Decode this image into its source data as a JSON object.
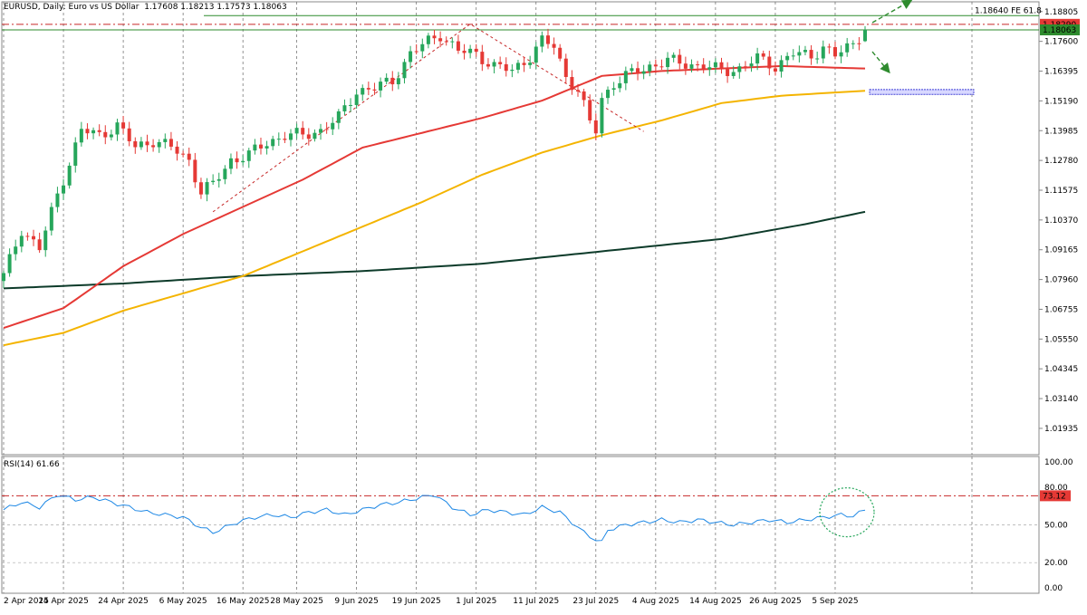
{
  "header": {
    "symbol": "EURUSD",
    "timeframe": "Daily",
    "description": "Euro vs US Dollar",
    "ohlc": "1.17608 1.18213 1.17573 1.18063"
  },
  "rsi_header": "RSI(14) 61.66",
  "fe_label": "1.18640 FE 61.8",
  "colors": {
    "bull": "#26a65b",
    "bear": "#e53935",
    "ma50": "#e53935",
    "ma100": "#f4b400",
    "ma200": "#0d3b2a",
    "rsi": "#1e88e5",
    "fe_line": "#2e8b2e",
    "resist": "#c62828",
    "target_box": "#3f3fd6",
    "badge_red": "#e53935",
    "badge_green": "#2e8b2e"
  },
  "price_badges": [
    {
      "value": "1.18290",
      "kind": "red"
    },
    {
      "value": "1.18063",
      "kind": "green"
    }
  ],
  "chart_data": [
    {
      "type": "candlestick",
      "title": "EURUSD, Daily: Euro vs US Dollar",
      "ylim": [
        1.0087,
        1.192
      ],
      "y_ticks": [
        "1.18805",
        "1.17600",
        "1.16395",
        "1.15190",
        "1.13985",
        "1.12780",
        "1.11575",
        "1.10370",
        "1.09165",
        "1.07960",
        "1.06755",
        "1.05550",
        "1.04345",
        "1.03140",
        "1.01935"
      ],
      "x_ticks": [
        "2 Apr 2025",
        "14 Apr 2025",
        "24 Apr 2025",
        "6 May 2025",
        "16 May 2025",
        "28 May 2025",
        "9 Jun 2025",
        "19 Jun 2025",
        "1 Jul 2025",
        "11 Jul 2025",
        "23 Jul 2025",
        "4 Aug 2025",
        "14 Aug 2025",
        "26 Aug 2025",
        "5 Sep 2025"
      ],
      "anchors": [
        [
          0,
          1.081
        ],
        [
          3,
          1.1
        ],
        [
          6,
          1.092
        ],
        [
          9,
          1.114
        ],
        [
          13,
          1.14
        ],
        [
          16,
          1.138
        ],
        [
          19,
          1.142
        ],
        [
          22,
          1.133
        ],
        [
          25,
          1.136
        ],
        [
          28,
          1.133
        ],
        [
          31,
          1.128
        ],
        [
          33,
          1.115
        ],
        [
          35,
          1.118
        ],
        [
          38,
          1.128
        ],
        [
          41,
          1.13
        ],
        [
          44,
          1.135
        ],
        [
          47,
          1.138
        ],
        [
          50,
          1.138
        ],
        [
          53,
          1.14
        ],
        [
          56,
          1.145
        ],
        [
          59,
          1.156
        ],
        [
          62,
          1.157
        ],
        [
          65,
          1.16
        ],
        [
          68,
          1.171
        ],
        [
          71,
          1.176
        ],
        [
          73,
          1.179
        ],
        [
          76,
          1.172
        ],
        [
          79,
          1.171
        ],
        [
          82,
          1.166
        ],
        [
          85,
          1.164
        ],
        [
          88,
          1.17
        ],
        [
          90,
          1.176
        ],
        [
          92,
          1.174
        ],
        [
          94,
          1.162
        ],
        [
          96,
          1.156
        ],
        [
          98,
          1.143
        ],
        [
          99,
          1.14
        ],
        [
          100,
          1.153
        ],
        [
          102,
          1.159
        ],
        [
          105,
          1.163
        ],
        [
          108,
          1.166
        ],
        [
          111,
          1.168
        ],
        [
          114,
          1.167
        ],
        [
          117,
          1.166
        ],
        [
          120,
          1.164
        ],
        [
          123,
          1.165
        ],
        [
          126,
          1.169
        ],
        [
          129,
          1.166
        ],
        [
          132,
          1.171
        ],
        [
          135,
          1.17
        ],
        [
          137,
          1.174
        ],
        [
          139,
          1.17
        ],
        [
          142,
          1.175
        ],
        [
          144,
          1.1806
        ]
      ],
      "ma50": [
        [
          0,
          1.06
        ],
        [
          10,
          1.068
        ],
        [
          20,
          1.085
        ],
        [
          30,
          1.098
        ],
        [
          40,
          1.109
        ],
        [
          50,
          1.12
        ],
        [
          60,
          1.133
        ],
        [
          70,
          1.139
        ],
        [
          80,
          1.145
        ],
        [
          90,
          1.152
        ],
        [
          100,
          1.162
        ],
        [
          110,
          1.164
        ],
        [
          120,
          1.165
        ],
        [
          130,
          1.166
        ],
        [
          144,
          1.165
        ]
      ],
      "ma100": [
        [
          0,
          1.053
        ],
        [
          10,
          1.058
        ],
        [
          20,
          1.067
        ],
        [
          30,
          1.074
        ],
        [
          40,
          1.081
        ],
        [
          50,
          1.091
        ],
        [
          60,
          1.101
        ],
        [
          70,
          1.111
        ],
        [
          80,
          1.122
        ],
        [
          90,
          1.131
        ],
        [
          100,
          1.138
        ],
        [
          110,
          1.144
        ],
        [
          120,
          1.151
        ],
        [
          130,
          1.154
        ],
        [
          144,
          1.156
        ]
      ],
      "ma200": [
        [
          0,
          1.076
        ],
        [
          20,
          1.078
        ],
        [
          40,
          1.081
        ],
        [
          60,
          1.083
        ],
        [
          80,
          1.086
        ],
        [
          100,
          1.091
        ],
        [
          120,
          1.096
        ],
        [
          134,
          1.102
        ],
        [
          144,
          1.107
        ]
      ],
      "fe_level": 1.1864,
      "resist_level": 1.1829,
      "current_level": 1.18063,
      "swing_low": [
        35,
        1.107
      ],
      "swing_high": [
        78,
        1.183
      ],
      "retrace_low": [
        107,
        1.1395
      ],
      "projection": [
        144,
        1.1864
      ],
      "target_zone": [
        1.1545,
        1.1565
      ]
    },
    {
      "type": "line",
      "title": "RSI(14) 61.66",
      "ylim": [
        0,
        100
      ],
      "y_ticks": [
        "100.00",
        "80.00",
        "73.12",
        "50.00",
        "20.00",
        "0.00"
      ],
      "overbought": 80,
      "highlight_level": 73.12,
      "last_value": 61.66,
      "anchors": [
        [
          0,
          62
        ],
        [
          3,
          68
        ],
        [
          6,
          64
        ],
        [
          9,
          74
        ],
        [
          12,
          70
        ],
        [
          15,
          72
        ],
        [
          18,
          68
        ],
        [
          21,
          64
        ],
        [
          24,
          60
        ],
        [
          27,
          58
        ],
        [
          30,
          56
        ],
        [
          33,
          48
        ],
        [
          35,
          44
        ],
        [
          37,
          48
        ],
        [
          39,
          52
        ],
        [
          42,
          56
        ],
        [
          45,
          58
        ],
        [
          48,
          56
        ],
        [
          51,
          60
        ],
        [
          54,
          62
        ],
        [
          57,
          58
        ],
        [
          60,
          62
        ],
        [
          63,
          66
        ],
        [
          66,
          68
        ],
        [
          69,
          71
        ],
        [
          72,
          74
        ],
        [
          75,
          64
        ],
        [
          78,
          58
        ],
        [
          81,
          62
        ],
        [
          84,
          60
        ],
        [
          87,
          58
        ],
        [
          90,
          64
        ],
        [
          93,
          60
        ],
        [
          95,
          52
        ],
        [
          97,
          44
        ],
        [
          99,
          38
        ],
        [
          100,
          36
        ],
        [
          101,
          46
        ],
        [
          104,
          50
        ],
        [
          107,
          52
        ],
        [
          110,
          54
        ],
        [
          113,
          52
        ],
        [
          116,
          54
        ],
        [
          119,
          52
        ],
        [
          122,
          50
        ],
        [
          125,
          52
        ],
        [
          128,
          54
        ],
        [
          131,
          52
        ],
        [
          134,
          54
        ],
        [
          137,
          56
        ],
        [
          140,
          58
        ],
        [
          142,
          57
        ],
        [
          144,
          61.66
        ]
      ]
    }
  ]
}
